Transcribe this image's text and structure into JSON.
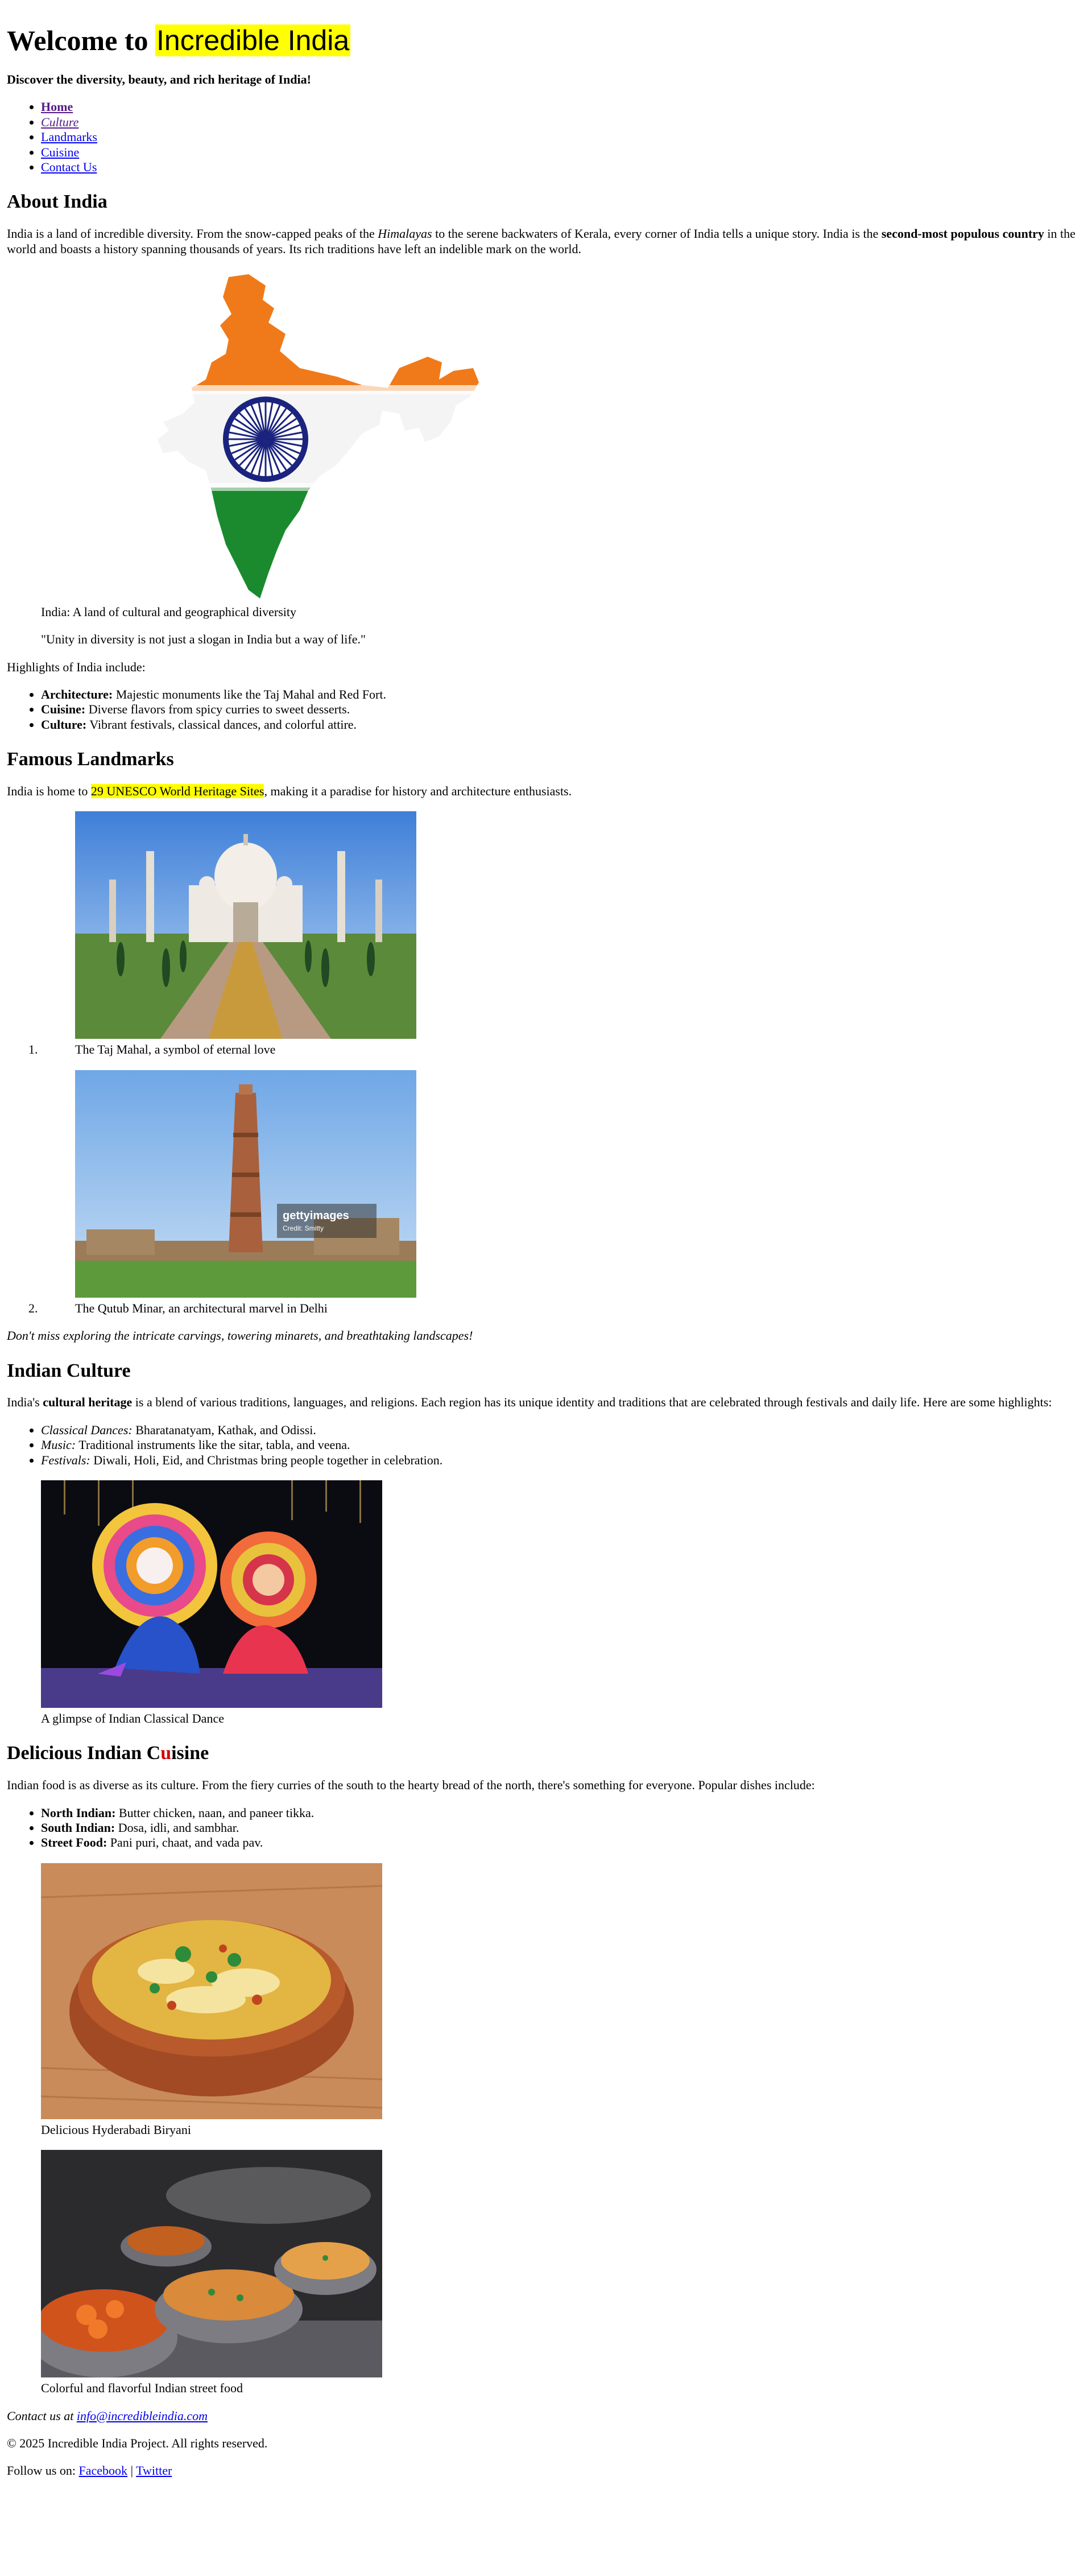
{
  "header": {
    "title_prefix": "Welcome to",
    "title_highlight": "Incredible India",
    "tagline": "Discover the diversity, beauty, and rich heritage of India!"
  },
  "nav": {
    "items": [
      {
        "label": "Home"
      },
      {
        "label": "Culture"
      },
      {
        "label": "Landmarks"
      },
      {
        "label": "Cuisine"
      },
      {
        "label": "Contact Us"
      }
    ]
  },
  "about": {
    "heading": "About India",
    "p1_a": "India is a land of incredible diversity. From the snow-capped peaks of the ",
    "p1_em": "Himalayas",
    "p1_b": " to the serene backwaters of Kerala, every corner of India tells a unique story. India is the ",
    "p1_strong": "second-most populous country",
    "p1_c": " in the world and boasts a history spanning thousands of years. Its rich traditions have left an indelible mark on the world.",
    "map_caption": "India: A land of cultural and geographical diversity",
    "quote": "\"Unity in diversity is not just a slogan in India but a way of life.\"",
    "highlights_intro": "Highlights of India include:",
    "highlights": [
      {
        "term": "Architecture:",
        "text": " Majestic monuments like the Taj Mahal and Red Fort."
      },
      {
        "term": "Cuisine:",
        "text": " Diverse flavors from spicy curries to sweet desserts."
      },
      {
        "term": "Culture:",
        "text": " Vibrant festivals, classical dances, and colorful attire."
      }
    ]
  },
  "landmarks": {
    "heading": "Famous Landmarks",
    "intro_a": "India is home to ",
    "intro_mark": "29 UNESCO World Heritage Sites",
    "intro_b": ", making it a paradise for history and architecture enthusiasts.",
    "items": [
      {
        "caption": "The Taj Mahal, a symbol of eternal love"
      },
      {
        "caption": "The Qutub Minar, an architectural marvel in Delhi",
        "watermark": "gettyimages",
        "credit": "Credit: Smitty"
      }
    ],
    "outro": "Don't miss exploring the intricate carvings, towering minarets, and breathtaking landscapes!"
  },
  "culture": {
    "heading": "Indian Culture",
    "intro_a": "India's ",
    "intro_strong": "cultural heritage",
    "intro_b": " is a blend of various traditions, languages, and religions. Each region has its unique identity and traditions that are celebrated through festivals and daily life. Here are some highlights:",
    "items": [
      {
        "term": "Classical Dances:",
        "text": " Bharatanatyam, Kathak, and Odissi."
      },
      {
        "term": "Music:",
        "text": " Traditional instruments like the sitar, tabla, and veena."
      },
      {
        "term": "Festivals:",
        "text": " Diwali, Holi, Eid, and Christmas bring people together in celebration."
      }
    ],
    "image_caption": "A glimpse of Indian Classical Dance"
  },
  "cuisine": {
    "heading_a": "Delicious Indian C",
    "heading_b": "u",
    "heading_c": "isine",
    "intro": "Indian food is as diverse as its culture. From the fiery curries of the south to the hearty bread of the north, there's something for everyone. Popular dishes include:",
    "items": [
      {
        "term": "North Indian:",
        "text": " Butter chicken, naan, and paneer tikka."
      },
      {
        "term": "South Indian:",
        "text": " Dosa, idli, and sambhar."
      },
      {
        "term": "Street Food:",
        "text": " Pani puri, chaat, and vada pav."
      }
    ],
    "image1_caption": "Delicious Hyderabadi Biryani",
    "image2_caption": "Colorful and flavorful Indian street food"
  },
  "footer": {
    "contact_label": "Contact us at ",
    "email": "info@incredibleindia.com",
    "copyright": "© 2025 Incredible India Project. All rights reserved.",
    "follow_label": "Follow us on: ",
    "facebook": "Facebook",
    "separator": " | ",
    "twitter": "Twitter"
  },
  "colors": {
    "highlight": "#ffff00",
    "link": "#0000ee",
    "visited_link": "#551a8b",
    "saffron": "#f07a1a",
    "green": "#138808",
    "navy": "#000080"
  }
}
